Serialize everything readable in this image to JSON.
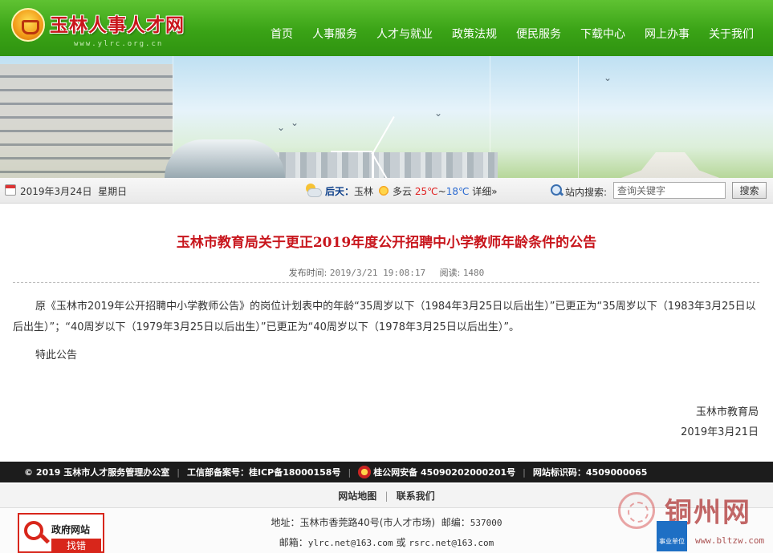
{
  "header": {
    "site_title": "玉林人事人才网",
    "site_url": "www.ylrc.org.cn",
    "nav": [
      {
        "label": "首页"
      },
      {
        "label": "人事服务"
      },
      {
        "label": "人才与就业"
      },
      {
        "label": "政策法规"
      },
      {
        "label": "便民服务"
      },
      {
        "label": "下载中心"
      },
      {
        "label": "网上办事"
      },
      {
        "label": "关于我们"
      }
    ],
    "accent_color": "#3aa316"
  },
  "infobar": {
    "date": "2019年3月24日",
    "weekday": "星期日",
    "weather_label": "后天：",
    "city": "玉林",
    "condition": "多云",
    "temp_high": "25℃",
    "temp_sep": "~",
    "temp_low": "18℃",
    "detail_link": "详细»",
    "search_label": "站内搜索:",
    "search_placeholder": "查询关键字",
    "search_button": "搜索"
  },
  "article": {
    "title": "玉林市教育局关于更正2019年度公开招聘中小学教师年龄条件的公告",
    "publish_label": "发布时间:",
    "publish_time": "2019/3/21 19:08:17",
    "views_label": "阅读:",
    "views": "1480",
    "body": "原《玉林市2019年公开招聘中小学教师公告》的岗位计划表中的年龄“35周岁以下（1984年3月25日以后出生）”已更正为“35周岁以下（1983年3月25日以后出生）”；“40周岁以下（1979年3月25日以后出生）”已更正为“40周岁以下（1978年3月25日以后出生）”。",
    "notice": "特此公告",
    "signature_org": "玉林市教育局",
    "signature_date": "2019年3月21日",
    "title_color": "#c8161d"
  },
  "footer": {
    "copyright": "© 2019 玉林市人才服务管理办公室",
    "icp_label": "工信部备案号：",
    "icp": "桂ICP备18000158号",
    "police": "桂公网安备 45090202000201号",
    "site_id_label": "网站标识码：",
    "site_id": "4509000065",
    "links": [
      {
        "label": "网站地图"
      },
      {
        "label": "联系我们"
      }
    ],
    "address_label": "地址：",
    "address": "玉林市香莞路40号(市人才市场)",
    "postcode_label": "邮编：",
    "postcode": "537000",
    "email_label": "邮箱：",
    "email1": "ylrc.net@163.com",
    "email_or": "或",
    "email2": "rsrc.net@163.com",
    "gov_badge_line1": "政府网站",
    "gov_badge_line2": "找错"
  },
  "watermark": {
    "name": "铜州网",
    "box_text": "事业单位",
    "url": "www.bltzw.com"
  }
}
